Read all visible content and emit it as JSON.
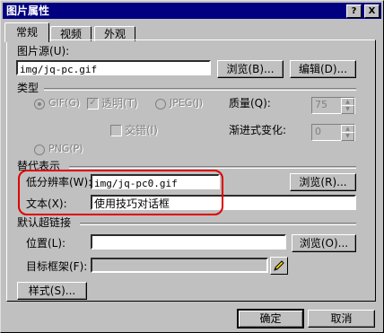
{
  "window": {
    "title": "图片属性",
    "help_glyph": "?",
    "close_glyph": "X"
  },
  "tabs": [
    {
      "label": "常规"
    },
    {
      "label": "视频"
    },
    {
      "label": "外观"
    }
  ],
  "image_source": {
    "label": "图片源",
    "hotkey": "(U):",
    "value": "img/jq-pc.gif",
    "browse_label": "浏览(B)...",
    "edit_label": "编辑(D)..."
  },
  "type": {
    "section_label": "类型",
    "gif_label": "GIF(G)",
    "transparent_label": "透明(T)",
    "jpeg_label": "JPEG(J)",
    "quality_label": "质量(Q):",
    "quality_value": "75",
    "interlaced_label": "交错(I)",
    "progressive_label": "渐进式变化:",
    "progressive_value": "0",
    "png_label": "PNG(P)"
  },
  "alternate": {
    "section_label": "替代表示",
    "low_res_label": "低分辨率(W):",
    "low_res_value": "img/jq-pc0.gif",
    "browse_label": "浏览(R)...",
    "text_label": "文本(X):",
    "text_value": "使用技巧对话框"
  },
  "hyperlink": {
    "section_label": "默认超链接",
    "location_label": "位置(L):",
    "location_value": "",
    "browse_label": "浏览(O)...",
    "target_label": "目标框架(F):",
    "target_value": ""
  },
  "style_button": "样式(S)...",
  "ok_button": "确定",
  "cancel_button": "取消",
  "colors": {
    "title_bar": "#000080",
    "highlight": "#e00000",
    "face": "#c0c0c0"
  }
}
